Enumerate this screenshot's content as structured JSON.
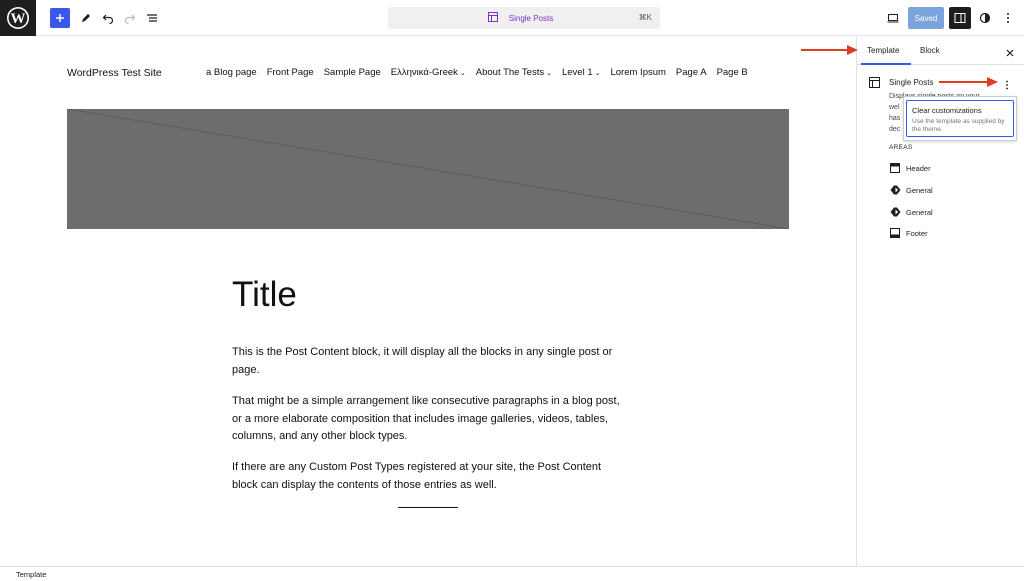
{
  "toolbar": {
    "command_title": "Single Posts",
    "command_shortcut": "⌘K",
    "saved_label": "Saved"
  },
  "site": {
    "title": "WordPress Test Site",
    "nav": [
      {
        "label": "a Blog page",
        "has_submenu": false
      },
      {
        "label": "Front Page",
        "has_submenu": false
      },
      {
        "label": "Sample Page",
        "has_submenu": false
      },
      {
        "label": "Ελληνικά-Greek",
        "has_submenu": true
      },
      {
        "label": "About The Tests",
        "has_submenu": true
      },
      {
        "label": "Level 1",
        "has_submenu": true
      },
      {
        "label": "Lorem Ipsum",
        "has_submenu": false
      },
      {
        "label": "Page A",
        "has_submenu": false
      },
      {
        "label": "Page B",
        "has_submenu": false
      }
    ]
  },
  "post": {
    "title": "Title",
    "paragraphs": [
      "This is the Post Content block, it will display all the blocks in any single post or page.",
      "That might be a simple arrangement like consecutive paragraphs in a blog post, or a more elaborate composition that includes image galleries, videos, tables, columns, and any other block types.",
      "If there are any Custom Post Types registered at your site, the Post Content block can display the contents of those entries as well."
    ]
  },
  "sidebar": {
    "tabs": [
      "Template",
      "Block"
    ],
    "template_name": "Single Posts",
    "description_lines": [
      "Displays single posts on your",
      "wel",
      "has",
      "dec"
    ],
    "popover": {
      "title": "Clear customizations",
      "help": "Use the template as supplied by the theme."
    },
    "areas_label": "AREAS",
    "areas": [
      {
        "label": "Header",
        "icon": "header-icon"
      },
      {
        "label": "General",
        "icon": "template-part-icon"
      },
      {
        "label": "General",
        "icon": "template-part-icon"
      },
      {
        "label": "Footer",
        "icon": "footer-icon"
      }
    ]
  },
  "footer": {
    "breadcrumb": "Template"
  },
  "colors": {
    "accent": "#3858e9",
    "annotation_arrow": "#e03c1f",
    "feature_image": "#6d6d6d"
  }
}
